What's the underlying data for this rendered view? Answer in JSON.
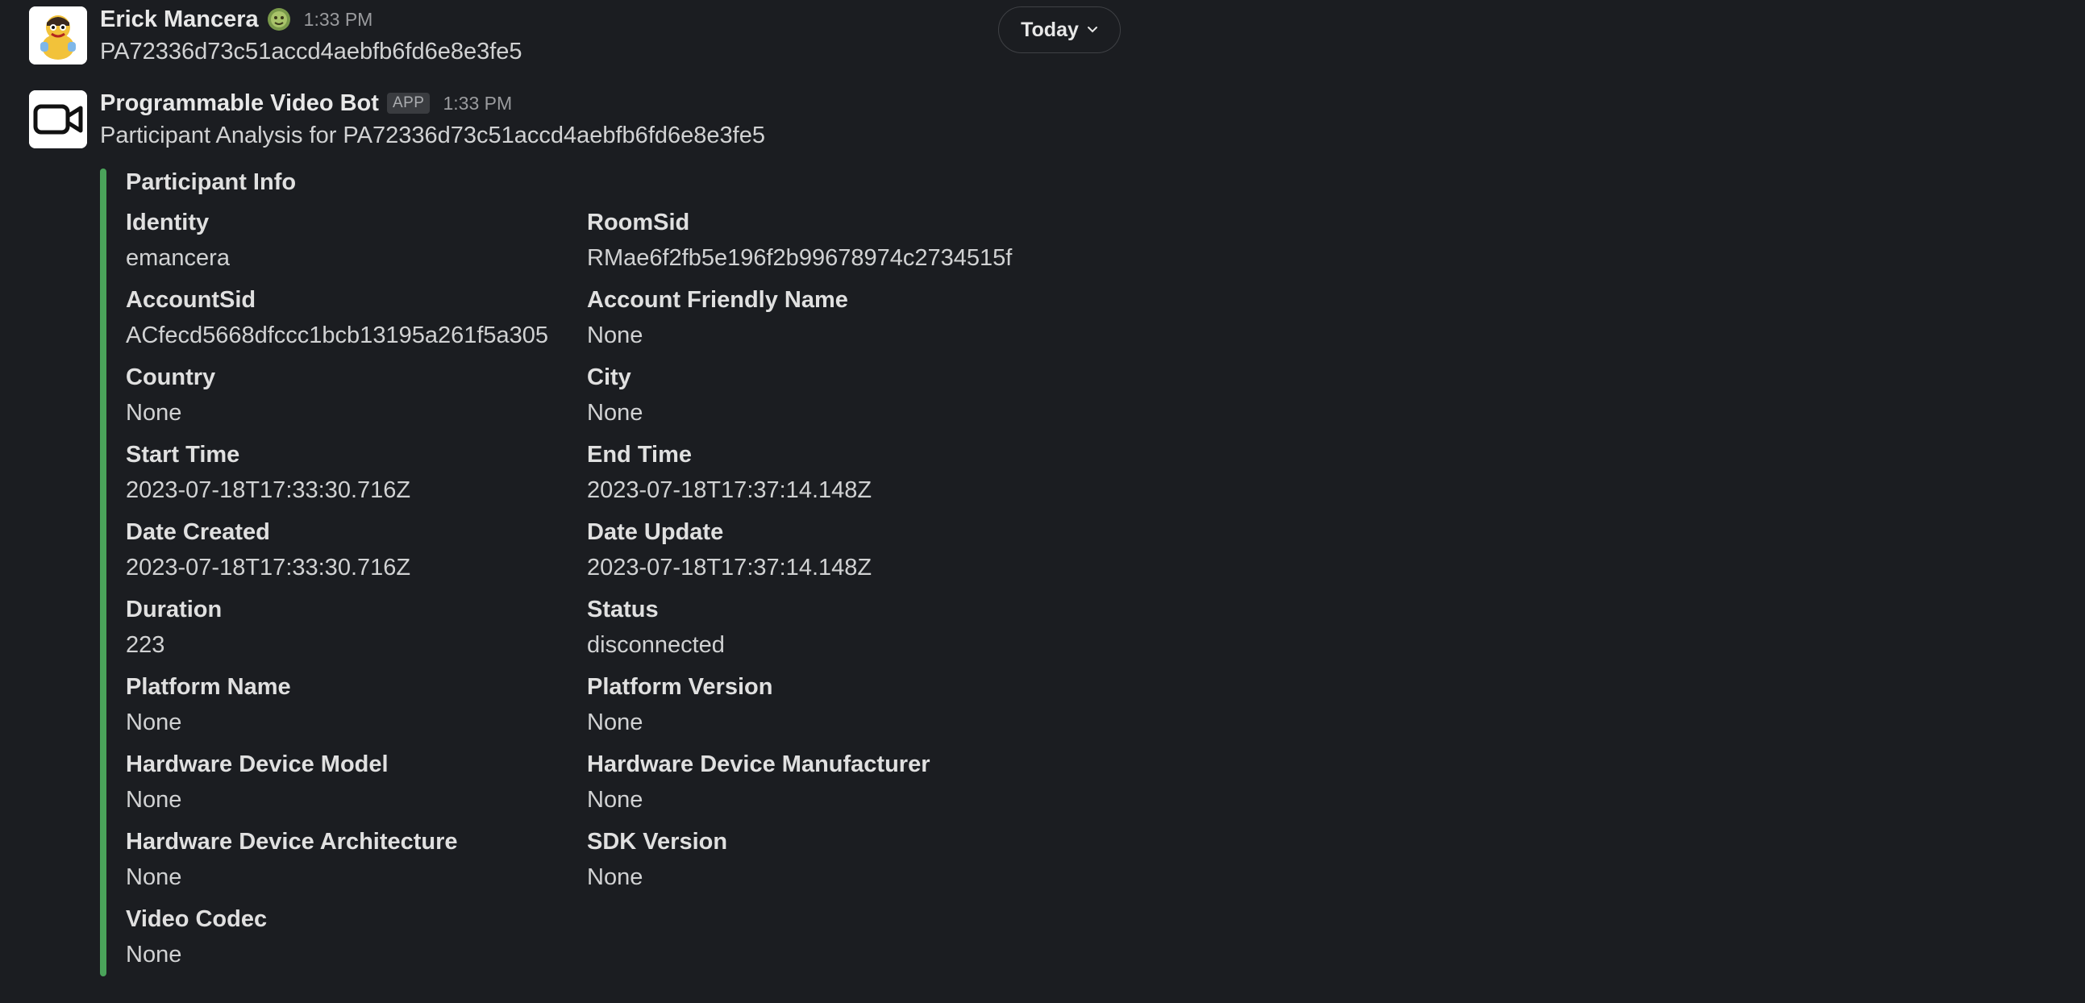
{
  "date_divider": {
    "label": "Today"
  },
  "messages": [
    {
      "sender": "Erick Mancera",
      "time": "1:33 PM",
      "text": "PA72336d73c51accd4aebfb6fd6e8e3fe5"
    },
    {
      "sender": "Programmable Video Bot",
      "badge": "APP",
      "time": "1:33 PM",
      "text": "Participant Analysis for PA72336d73c51accd4aebfb6fd6e8e3fe5"
    }
  ],
  "attachment": {
    "accent_color": "#4aa35a",
    "title": "Participant Info",
    "fields": [
      {
        "label": "Identity",
        "value": "emancera"
      },
      {
        "label": "RoomSid",
        "value": "RMae6f2fb5e196f2b99678974c2734515f"
      },
      {
        "label": "AccountSid",
        "value": "ACfecd5668dfccc1bcb13195a261f5a305"
      },
      {
        "label": "Account Friendly Name",
        "value": "None"
      },
      {
        "label": "Country",
        "value": "None"
      },
      {
        "label": "City",
        "value": "None"
      },
      {
        "label": "Start Time",
        "value": "2023-07-18T17:33:30.716Z"
      },
      {
        "label": "End Time",
        "value": "2023-07-18T17:37:14.148Z"
      },
      {
        "label": "Date Created",
        "value": "2023-07-18T17:33:30.716Z"
      },
      {
        "label": "Date Update",
        "value": "2023-07-18T17:37:14.148Z"
      },
      {
        "label": "Duration",
        "value": "223"
      },
      {
        "label": "Status",
        "value": "disconnected"
      },
      {
        "label": "Platform Name",
        "value": "None"
      },
      {
        "label": "Platform Version",
        "value": "None"
      },
      {
        "label": "Hardware Device Model",
        "value": "None"
      },
      {
        "label": "Hardware Device Manufacturer",
        "value": "None"
      },
      {
        "label": "Hardware Device Architecture",
        "value": "None"
      },
      {
        "label": "SDK Version",
        "value": "None"
      },
      {
        "label": "Video Codec",
        "value": "None"
      }
    ]
  }
}
